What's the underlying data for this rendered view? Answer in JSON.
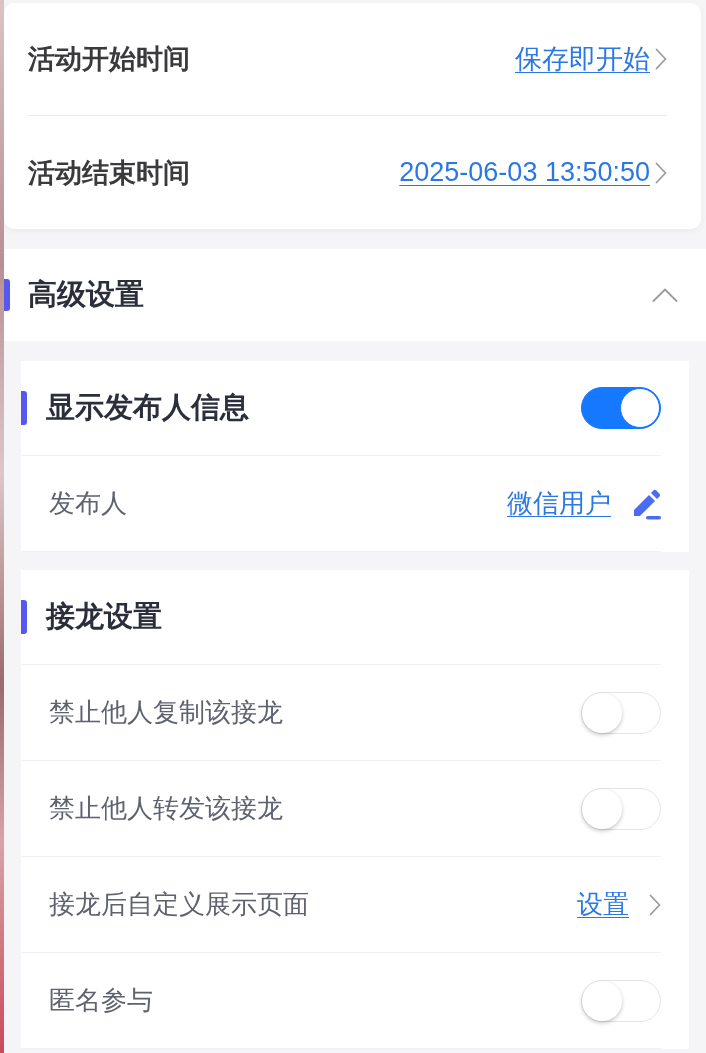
{
  "time_card": {
    "rows": [
      {
        "label": "活动开始时间",
        "value": "保存即开始"
      },
      {
        "label": "活动结束时间",
        "value": "2025-06-03 13:50:50"
      }
    ]
  },
  "advanced_settings": {
    "title": "高级设置",
    "expanded": true,
    "groups": [
      {
        "title": "显示发布人信息",
        "switch": {
          "on": true
        },
        "rows": [
          {
            "kind": "edit",
            "label": "发布人",
            "value": "微信用户"
          }
        ]
      },
      {
        "title": "接龙设置",
        "rows": [
          {
            "kind": "toggle",
            "label": "禁止他人复制该接龙",
            "on": false
          },
          {
            "kind": "toggle",
            "label": "禁止他人转发该接龙",
            "on": false
          },
          {
            "kind": "link",
            "label": "接龙后自定义展示页面",
            "value": "设置"
          },
          {
            "kind": "toggle",
            "label": "匿名参与",
            "on": false
          }
        ]
      }
    ]
  }
}
